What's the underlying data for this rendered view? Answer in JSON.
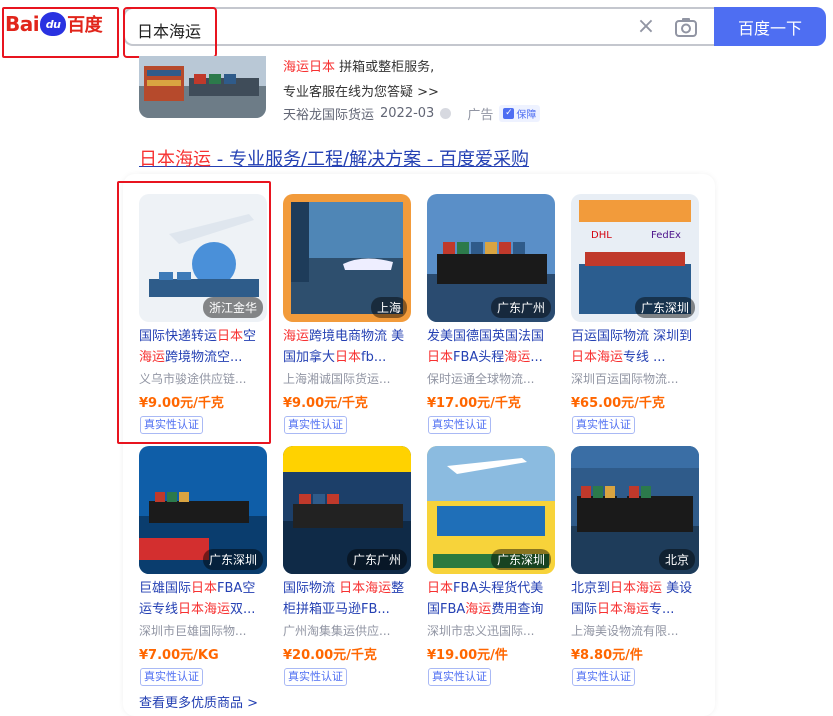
{
  "logo": {
    "bai": "Bai",
    "du": "du",
    "cn": "百度"
  },
  "search": {
    "query": "日本海运",
    "button_label": "百度一下"
  },
  "ad": {
    "line1_red": "海运日本",
    "line1_rest": "拼箱或整柜服务,",
    "line2": "专业客服在线为您答疑 >>",
    "company": "天裕龙国际货运",
    "date": "2022-03",
    "ad_label": "广告",
    "guarantee_label": "保障"
  },
  "result": {
    "title_red": "日本海运",
    "title_rest": " - 专业服务/工程/解决方案 - 百度爱采购"
  },
  "cards": [
    {
      "name_html": [
        "国际快递转运",
        "日本",
        "空",
        "海运",
        "跨境物流空..."
      ],
      "seller": "义乌市骏途供应链...",
      "price": "¥9.00元/千克",
      "loc": "浙江金华",
      "cert": "真实性认证"
    },
    {
      "name_html": [
        "",
        "海运",
        "跨境电商物流 美国加拿大",
        "日本",
        "fb..."
      ],
      "seller": "上海湘诚国际货运...",
      "price": "¥9.00元/千克",
      "loc": "上海",
      "cert": "真实性认证"
    },
    {
      "name_html": [
        "发美国德国英国法国",
        "日本",
        "FBA头程",
        "海运",
        "..."
      ],
      "seller": "保时运通全球物流...",
      "price": "¥17.00元/千克",
      "loc": "广东广州",
      "cert": "真实性认证"
    },
    {
      "name_html": [
        "百运国际物流 深圳到",
        "日本海运",
        "专线 ..."
      ],
      "seller": "深圳百运国际物流...",
      "price": "¥65.00元/千克",
      "loc": "广东深圳",
      "cert": "真实性认证"
    },
    {
      "name_html": [
        "巨雄国际",
        "日本",
        "FBA空运专线",
        "日本海运",
        "双..."
      ],
      "seller": "深圳市巨雄国际物...",
      "price": "¥7.00元/KG",
      "loc": "广东深圳",
      "cert": "真实性认证"
    },
    {
      "name_html": [
        "国际物流 ",
        "日本海运",
        "整柜拼箱亚马逊FB..."
      ],
      "seller": "广州淘集集运供应...",
      "price": "¥20.00元/千克",
      "loc": "广东广州",
      "cert": "真实性认证"
    },
    {
      "name_html": [
        "",
        "日本",
        "FBA头程货代美国FBA",
        "海运",
        "费用查询"
      ],
      "seller": "深圳市忠义迅国际...",
      "price": "¥19.00元/件",
      "loc": "广东深圳",
      "cert": "真实性认证"
    },
    {
      "name_html": [
        "北京到",
        "日本海运",
        " 美设国际",
        "日本海运",
        "专..."
      ],
      "seller": "上海美设物流有限...",
      "price": "¥8.80元/件",
      "loc": "北京",
      "cert": "真实性认证"
    }
  ],
  "more_label": "查看更多优质商品 >",
  "colors": {
    "brand_blue": "#4e6ef2",
    "link_blue": "#2440b3",
    "highlight_red": "#f73131",
    "price_orange": "#ff6600",
    "annotation_red": "#e8141f"
  }
}
